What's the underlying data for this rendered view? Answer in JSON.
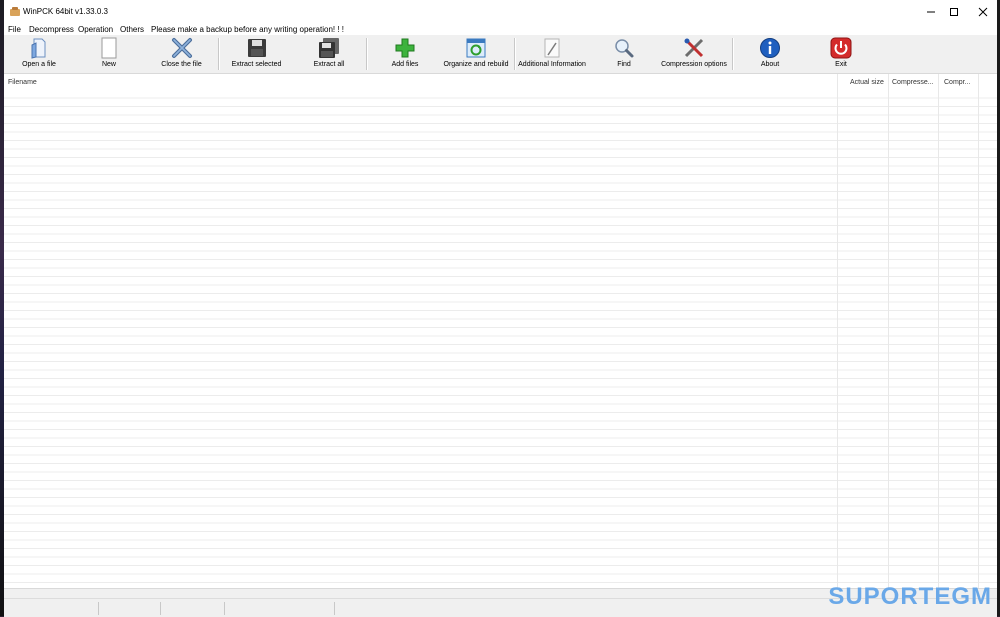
{
  "window": {
    "title": "WinPCK 64bit v1.33.0.3"
  },
  "menu": [
    {
      "label": "File"
    },
    {
      "label": "Decompress"
    },
    {
      "label": "Operation"
    },
    {
      "label": "Others"
    },
    {
      "label": "Please make a backup before any writing operation! ! !"
    }
  ],
  "toolbar": {
    "open": "Open a file",
    "new": "New",
    "close": "Close the file",
    "extract_selected": "Extract selected",
    "extract_all": "Extract all",
    "add_files": "Add files",
    "organize": "Organize and rebuild",
    "additional_info": "Additional Information",
    "find": "Find",
    "compression_options": "Compression options",
    "about": "About",
    "exit": "Exit"
  },
  "columns": {
    "filename": "Filename",
    "actual_size": "Actual size",
    "compressed": "Compresse...",
    "compression": "Compr..."
  },
  "watermark": "SUPORTEGM"
}
